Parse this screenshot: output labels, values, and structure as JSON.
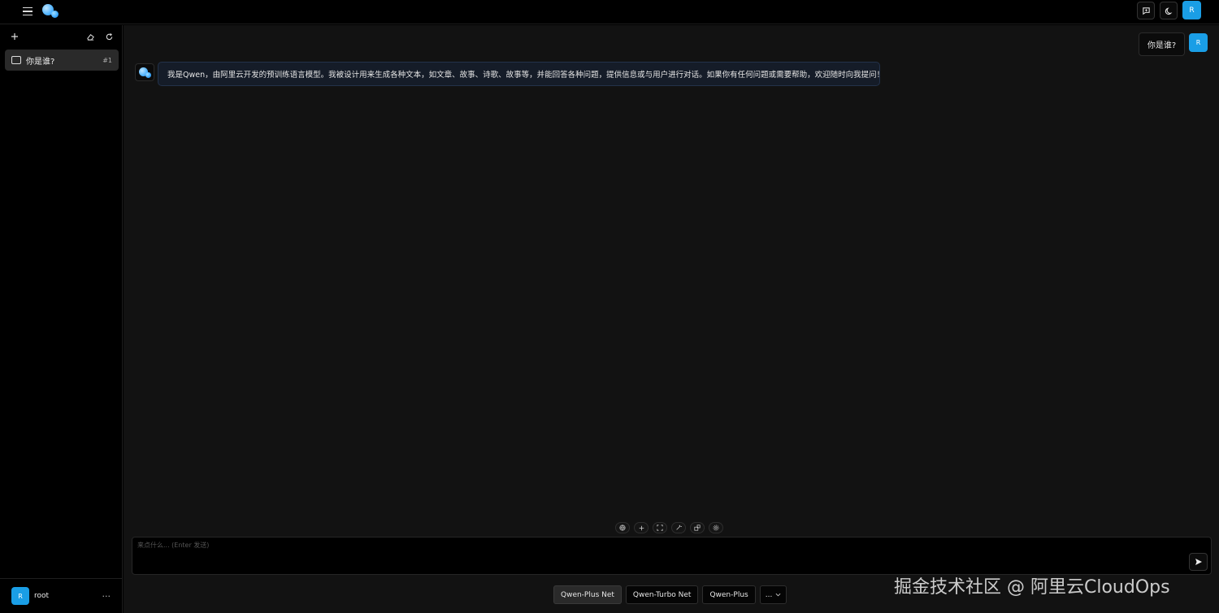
{
  "topbar": {
    "new_chat_icon": "message-plus-icon",
    "theme_icon": "moon-icon",
    "avatar_initial": "R"
  },
  "sidebar": {
    "new_icon": "plus-icon",
    "clear_icon": "eraser-icon",
    "refresh_icon": "refresh-icon",
    "chats": [
      {
        "title": "你是谁?",
        "count": "#1"
      }
    ],
    "user": {
      "initial": "R",
      "name": "root",
      "more": "···"
    }
  },
  "conversation": {
    "user_message": "你是谁?",
    "user_initial": "R",
    "assistant_message": "我是Qwen，由阿里云开发的预训练语言模型。我被设计用来生成各种文本，如文章、故事、诗歌、故事等，并能回答各种问题，提供信息或与用户进行对话。如果你有任何问题或需要帮助，欢迎随时向我提问！"
  },
  "composer": {
    "placeholder": "来点什么... (Enter 发送)",
    "tools": [
      "globe-icon",
      "plus-icon",
      "expand-icon",
      "magic-wand-icon",
      "plugins-icon",
      "settings-icon"
    ],
    "send_icon": "send-icon"
  },
  "models": {
    "items": [
      "Qwen-Plus Net",
      "Qwen-Turbo Net",
      "Qwen-Plus"
    ],
    "active": "Qwen-Plus Net",
    "more_label": "..."
  },
  "watermark": "掘金技术社区 @ 阿里云CloudOps",
  "colors": {
    "accent": "#1a9ee6",
    "background": "#121212",
    "sidebar": "#000000",
    "assistant_bubble": "#151c28"
  }
}
